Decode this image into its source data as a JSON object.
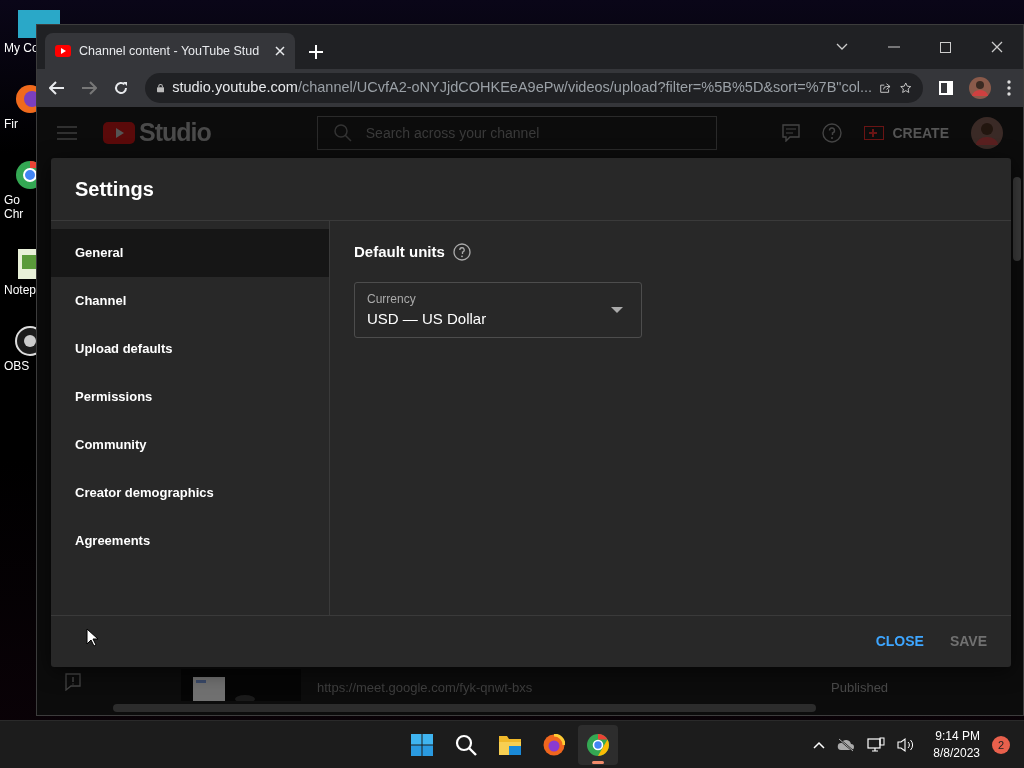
{
  "desktop_icons": [
    {
      "kind": "monitor",
      "lines": [
        "My Co"
      ]
    },
    {
      "kind": "firefox",
      "lines": [
        "Fir"
      ]
    },
    {
      "kind": "chrome",
      "lines": [
        "Go",
        "Chr"
      ]
    },
    {
      "kind": "notepad",
      "lines": [
        "Notep"
      ]
    },
    {
      "kind": "obs",
      "lines": [
        "OBS"
      ]
    }
  ],
  "browser": {
    "tab": {
      "title": "Channel content - YouTube Stud",
      "selected": true
    },
    "url_host": "studio.youtube.com",
    "url_path": "/channel/UCvfA2-oNYJjdCOHKEeA9ePw/videos/upload?filter=%5B%5D&sort=%7B\"col..."
  },
  "studio": {
    "logo": "Studio",
    "search_placeholder": "Search across your channel",
    "create": "CREATE",
    "row_link": "https://meet.google.com/fyk-qnwt-bxs",
    "row_status": "Published"
  },
  "settings": {
    "title": "Settings",
    "nav": [
      {
        "label": "General",
        "selected": true
      },
      {
        "label": "Channel",
        "selected": false
      },
      {
        "label": "Upload defaults",
        "selected": false
      },
      {
        "label": "Permissions",
        "selected": false
      },
      {
        "label": "Community",
        "selected": false
      },
      {
        "label": "Creator demographics",
        "selected": false
      },
      {
        "label": "Agreements",
        "selected": false
      }
    ],
    "section": "Default units",
    "currency": {
      "label": "Currency",
      "value": "USD — US Dollar"
    },
    "buttons": [
      {
        "label": "CLOSE",
        "disabled": false
      },
      {
        "label": "SAVE",
        "disabled": true
      }
    ]
  },
  "taskbar": {
    "apps": [
      {
        "kind": "start",
        "selected": false
      },
      {
        "kind": "search",
        "selected": false
      },
      {
        "kind": "files",
        "selected": false
      },
      {
        "kind": "firefox",
        "selected": false
      },
      {
        "kind": "chrome",
        "selected": true
      }
    ],
    "time": "9:14 PM",
    "date": "8/8/2023",
    "notifications": "2"
  }
}
